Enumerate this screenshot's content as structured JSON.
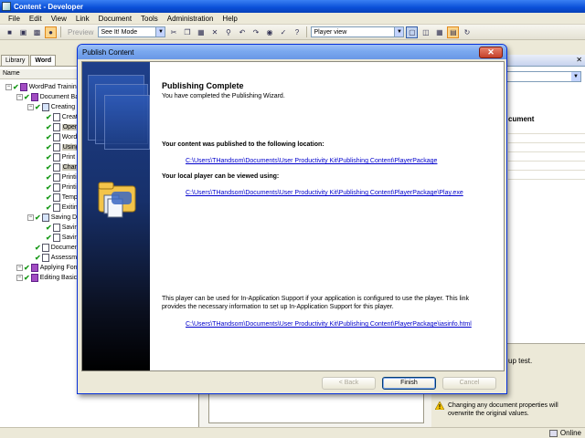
{
  "app": {
    "title": "Content - Developer"
  },
  "menu": [
    "File",
    "Edit",
    "View",
    "Link",
    "Document",
    "Tools",
    "Administration",
    "Help"
  ],
  "toolbar": {
    "preview_label": "Preview",
    "mode_select": "See It! Mode",
    "view_select": "Player view"
  },
  "left_pane": {
    "tabs": [
      "Library",
      "Word"
    ],
    "column_header": "Name",
    "tree": [
      {
        "label": "WordPad Training",
        "level": 0,
        "type": "purple"
      },
      {
        "label": "Document Ba",
        "level": 1,
        "type": "purple"
      },
      {
        "label": "Creating",
        "level": 2,
        "type": "blue"
      },
      {
        "label": "Creat",
        "level": 3,
        "type": "doc"
      },
      {
        "label": "Open",
        "level": 3,
        "type": "doc",
        "selected": true
      },
      {
        "label": "Word",
        "level": 3,
        "type": "doc"
      },
      {
        "label": "Using",
        "level": 3,
        "type": "doc",
        "selected": true
      },
      {
        "label": "Print",
        "level": 3,
        "type": "doc"
      },
      {
        "label": "Chan",
        "level": 3,
        "type": "doc",
        "selected": true
      },
      {
        "label": "Printi",
        "level": 3,
        "type": "doc"
      },
      {
        "label": "Printi",
        "level": 3,
        "type": "doc"
      },
      {
        "label": "Temp",
        "level": 3,
        "type": "doc"
      },
      {
        "label": "Exitin",
        "level": 3,
        "type": "doc"
      },
      {
        "label": "Saving D",
        "level": 2,
        "type": "blue"
      },
      {
        "label": "Savin",
        "level": 3,
        "type": "doc"
      },
      {
        "label": "Savin",
        "level": 3,
        "type": "doc"
      },
      {
        "label": "Documen",
        "level": 2,
        "type": "doc"
      },
      {
        "label": "Assessm",
        "level": 2,
        "type": "doc"
      },
      {
        "label": "Applying Forr",
        "level": 1,
        "type": "purple"
      },
      {
        "label": "Editing Basic",
        "level": 1,
        "type": "purple"
      }
    ]
  },
  "right_pane": {
    "column_label": "cument",
    "note": "up test.",
    "warning": "Changing any document properties will overwrite the original values."
  },
  "status": {
    "online": "Online"
  },
  "dialog": {
    "title": "Publish Content",
    "heading": "Publishing Complete",
    "subheading": "You have completed the Publishing Wizard.",
    "published_label": "Your content was published to the following location:",
    "published_link": "C:\\Users\\THandsom\\Documents\\User Productivity Kit\\Publishing Content\\PlayerPackage",
    "player_label": "Your local player can be viewed using:",
    "player_link": "C:\\Users\\THandsom\\Documents\\User Productivity Kit\\Publishing Content\\PlayerPackage\\Play.exe",
    "support_text": "This player can be used for In-Application Support if your application is configured to use the player. This link provides the necessary information to set up In-Application Support for this player.",
    "support_link": "C:\\Users\\THandsom\\Documents\\User Productivity Kit\\Publishing Content\\PlayerPackage\\iasinfo.html",
    "buttons": {
      "back": "< Back",
      "finish": "Finish",
      "cancel": "Cancel"
    }
  }
}
